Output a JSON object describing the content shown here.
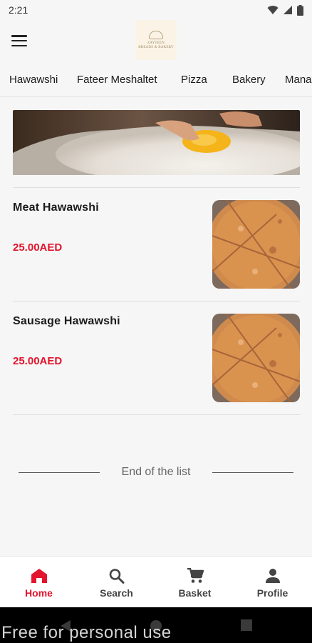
{
  "status_bar": {
    "time": "2:21"
  },
  "logo": {
    "line1": "ZAYTEEN",
    "line2": "BREADS & BAKERY"
  },
  "tabs": [
    {
      "label": "Hawawshi",
      "active": true
    },
    {
      "label": "Fateer Meshaltet",
      "active": false
    },
    {
      "label": "Pizza",
      "active": false
    },
    {
      "label": "Bakery",
      "active": false
    },
    {
      "label": "Mana",
      "active": false
    }
  ],
  "products": [
    {
      "name": "Meat Hawawshi",
      "price": "25.00AED"
    },
    {
      "name": "Sausage Hawawshi",
      "price": "25.00AED"
    }
  ],
  "end_of_list": "End of the list",
  "bottom_nav": [
    {
      "label": "Home",
      "icon": "home-icon",
      "active": true
    },
    {
      "label": "Search",
      "icon": "search-icon",
      "active": false
    },
    {
      "label": "Basket",
      "icon": "cart-icon",
      "active": false
    },
    {
      "label": "Profile",
      "icon": "person-icon",
      "active": false
    }
  ],
  "watermark": "Free for personal use",
  "colors": {
    "accent": "#e3142d",
    "tab_indicator": "#e9788a",
    "background": "#f6f6f6"
  }
}
